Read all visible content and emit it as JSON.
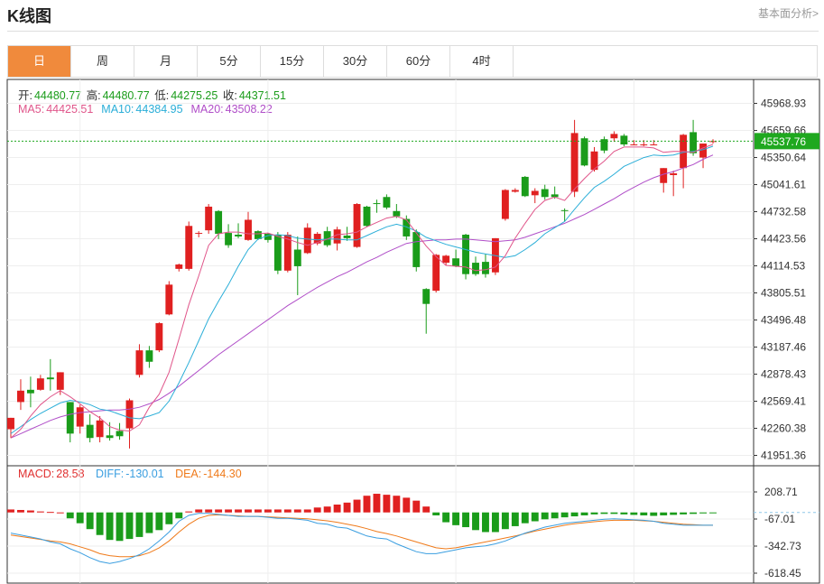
{
  "header": {
    "title": "K线图",
    "fundamental_link": "基本面分析>"
  },
  "tabs": [
    "日",
    "周",
    "月",
    "5分",
    "15分",
    "30分",
    "60分",
    "4时"
  ],
  "active_tab": 0,
  "ohlc_info": {
    "open_label": "开:",
    "open": "44480.77",
    "high_label": "高:",
    "high": "44480.77",
    "low_label": "低:",
    "low": "44275.25",
    "close_label": "收:",
    "close": "44371.51"
  },
  "ma_info": {
    "ma5_label": "MA5:",
    "ma5": "44425.51",
    "ma10_label": "MA10:",
    "ma10": "44384.95",
    "ma20_label": "MA20:",
    "ma20": "43508.22"
  },
  "macd_info": {
    "macd_label": "MACD:",
    "macd": "28.58",
    "diff_label": "DIFF:",
    "diff": "-130.01",
    "dea_label": "DEA:",
    "dea": "-144.30"
  },
  "colors": {
    "up": "#e02020",
    "down": "#1a9c1a",
    "ma5": "#e0558a",
    "ma10": "#2aaed8",
    "ma20": "#b04ec8",
    "diff": "#3a9ee0",
    "dea": "#ef7a1a",
    "tab_active": "#f08a3c",
    "current_price": "#1fa81f"
  },
  "chart_data": {
    "type": "candlestick",
    "price_axis_ticks": [
      "45968.93",
      "45659.66",
      "45350.64",
      "45041.61",
      "44732.58",
      "44423.56",
      "44114.53",
      "43805.51",
      "43496.48",
      "43187.46",
      "42878.43",
      "42569.41",
      "42260.38",
      "41951.36"
    ],
    "price_ylim": [
      41951.36,
      45968.93
    ],
    "current_price": "45537.76",
    "macd_axis_ticks": [
      "208.71",
      "-67.01",
      "-342.73",
      "-618.45"
    ],
    "macd_ylim": [
      -618.45,
      208.71
    ],
    "candles": [
      {
        "o": 42250,
        "h": 42380,
        "l": 42150,
        "c": 42380
      },
      {
        "o": 42560,
        "h": 42820,
        "l": 42470,
        "c": 42690
      },
      {
        "o": 42700,
        "h": 42850,
        "l": 42500,
        "c": 42660
      },
      {
        "o": 42700,
        "h": 42870,
        "l": 42690,
        "c": 42830
      },
      {
        "o": 42840,
        "h": 43050,
        "l": 42690,
        "c": 42820
      },
      {
        "o": 42700,
        "h": 42900,
        "l": 42640,
        "c": 42900
      },
      {
        "o": 42560,
        "h": 42560,
        "l": 42100,
        "c": 42200
      },
      {
        "o": 42280,
        "h": 42530,
        "l": 42200,
        "c": 42500
      },
      {
        "o": 42300,
        "h": 42420,
        "l": 42100,
        "c": 42150
      },
      {
        "o": 42160,
        "h": 42400,
        "l": 42100,
        "c": 42350
      },
      {
        "o": 42180,
        "h": 42330,
        "l": 42120,
        "c": 42150
      },
      {
        "o": 42230,
        "h": 42320,
        "l": 42130,
        "c": 42170
      },
      {
        "o": 42260,
        "h": 42600,
        "l": 42030,
        "c": 42580
      },
      {
        "o": 42870,
        "h": 43220,
        "l": 42840,
        "c": 43150
      },
      {
        "o": 43150,
        "h": 43200,
        "l": 42950,
        "c": 43020
      },
      {
        "o": 43150,
        "h": 43470,
        "l": 43130,
        "c": 43460
      },
      {
        "o": 43560,
        "h": 43940,
        "l": 43550,
        "c": 43900
      },
      {
        "o": 44080,
        "h": 44140,
        "l": 44050,
        "c": 44130
      },
      {
        "o": 44080,
        "h": 44620,
        "l": 44060,
        "c": 44570
      },
      {
        "o": 44480,
        "h": 44510,
        "l": 44440,
        "c": 44490
      },
      {
        "o": 44520,
        "h": 44820,
        "l": 44480,
        "c": 44790
      },
      {
        "o": 44740,
        "h": 44750,
        "l": 44420,
        "c": 44480
      },
      {
        "o": 44490,
        "h": 44590,
        "l": 44320,
        "c": 44350
      },
      {
        "o": 44470,
        "h": 44600,
        "l": 44430,
        "c": 44450
      },
      {
        "o": 44410,
        "h": 44730,
        "l": 44400,
        "c": 44640
      },
      {
        "o": 44510,
        "h": 44520,
        "l": 44410,
        "c": 44420
      },
      {
        "o": 44480,
        "h": 44490,
        "l": 44380,
        "c": 44410
      },
      {
        "o": 44470,
        "h": 44500,
        "l": 44020,
        "c": 44060
      },
      {
        "o": 44060,
        "h": 44500,
        "l": 44040,
        "c": 44470
      },
      {
        "o": 44300,
        "h": 44450,
        "l": 43780,
        "c": 44110
      },
      {
        "o": 44260,
        "h": 44600,
        "l": 44250,
        "c": 44550
      },
      {
        "o": 44370,
        "h": 44500,
        "l": 44350,
        "c": 44480
      },
      {
        "o": 44510,
        "h": 44560,
        "l": 44330,
        "c": 44350
      },
      {
        "o": 44370,
        "h": 44560,
        "l": 44290,
        "c": 44530
      },
      {
        "o": 44460,
        "h": 44560,
        "l": 44400,
        "c": 44430
      },
      {
        "o": 44330,
        "h": 44830,
        "l": 44320,
        "c": 44820
      },
      {
        "o": 44790,
        "h": 44800,
        "l": 44560,
        "c": 44570
      },
      {
        "o": 44830,
        "h": 44870,
        "l": 44720,
        "c": 44820
      },
      {
        "o": 44900,
        "h": 44930,
        "l": 44760,
        "c": 44780
      },
      {
        "o": 44740,
        "h": 44820,
        "l": 44660,
        "c": 44680
      },
      {
        "o": 44650,
        "h": 44690,
        "l": 44410,
        "c": 44450
      },
      {
        "o": 44500,
        "h": 44530,
        "l": 44050,
        "c": 44100
      },
      {
        "o": 43850,
        "h": 43860,
        "l": 43340,
        "c": 43680
      },
      {
        "o": 43830,
        "h": 44250,
        "l": 43810,
        "c": 44240
      },
      {
        "o": 44150,
        "h": 44240,
        "l": 44120,
        "c": 44230
      },
      {
        "o": 44200,
        "h": 44300,
        "l": 44100,
        "c": 44110
      },
      {
        "o": 44470,
        "h": 44480,
        "l": 43960,
        "c": 44020
      },
      {
        "o": 44150,
        "h": 44220,
        "l": 44000,
        "c": 44020
      },
      {
        "o": 44160,
        "h": 44250,
        "l": 43980,
        "c": 44020
      },
      {
        "o": 44040,
        "h": 44430,
        "l": 44010,
        "c": 44430
      },
      {
        "o": 44650,
        "h": 44990,
        "l": 44630,
        "c": 44980
      },
      {
        "o": 44960,
        "h": 45000,
        "l": 44950,
        "c": 44980
      },
      {
        "o": 45130,
        "h": 45140,
        "l": 44900,
        "c": 44910
      },
      {
        "o": 44920,
        "h": 45000,
        "l": 44830,
        "c": 44970
      },
      {
        "o": 44990,
        "h": 45040,
        "l": 44870,
        "c": 44900
      },
      {
        "o": 44930,
        "h": 45020,
        "l": 44880,
        "c": 44900
      },
      {
        "o": 44750,
        "h": 44770,
        "l": 44620,
        "c": 44740
      },
      {
        "o": 44960,
        "h": 45780,
        "l": 44900,
        "c": 45630
      },
      {
        "o": 45570,
        "h": 45590,
        "l": 45250,
        "c": 45260
      },
      {
        "o": 45210,
        "h": 45470,
        "l": 45190,
        "c": 45420
      },
      {
        "o": 45560,
        "h": 45590,
        "l": 45400,
        "c": 45430
      },
      {
        "o": 45570,
        "h": 45650,
        "l": 45530,
        "c": 45620
      },
      {
        "o": 45600,
        "h": 45620,
        "l": 45480,
        "c": 45500
      },
      {
        "o": 45500,
        "h": 45550,
        "l": 45490,
        "c": 45500
      },
      {
        "o": 45500,
        "h": 45550,
        "l": 45480,
        "c": 45500
      },
      {
        "o": 45500,
        "h": 45550,
        "l": 45490,
        "c": 45500
      },
      {
        "o": 45060,
        "h": 45230,
        "l": 44950,
        "c": 45230
      },
      {
        "o": 45150,
        "h": 45200,
        "l": 44910,
        "c": 45170
      },
      {
        "o": 45230,
        "h": 45620,
        "l": 45000,
        "c": 45610
      },
      {
        "o": 45640,
        "h": 45780,
        "l": 45370,
        "c": 45400
      },
      {
        "o": 45350,
        "h": 45510,
        "l": 45230,
        "c": 45510
      },
      {
        "o": 45530,
        "h": 45560,
        "l": 45510,
        "c": 45537.76
      }
    ],
    "ma5": [
      42150,
      42250,
      42400,
      42530,
      42620,
      42690,
      42620,
      42540,
      42450,
      42380,
      42280,
      42240,
      42230,
      42300,
      42500,
      42650,
      42900,
      43280,
      43670,
      44000,
      44350,
      44480,
      44500,
      44500,
      44480,
      44480,
      44490,
      44450,
      44420,
      44380,
      44350,
      44380,
      44420,
      44470,
      44480,
      44500,
      44560,
      44610,
      44660,
      44680,
      44640,
      44490,
      44340,
      44220,
      44120,
      44110,
      44100,
      44060,
      44070,
      44100,
      44230,
      44430,
      44600,
      44760,
      44860,
      44900,
      44860,
      44990,
      45110,
      45220,
      45310,
      45420,
      45470,
      45470,
      45470,
      45460,
      45410,
      45420,
      45420,
      45410,
      45460,
      45500
    ],
    "ma10": [
      42200,
      42280,
      42360,
      42430,
      42490,
      42550,
      42580,
      42560,
      42530,
      42480,
      42460,
      42420,
      42380,
      42370,
      42400,
      42440,
      42570,
      42780,
      43010,
      43260,
      43510,
      43710,
      43900,
      44110,
      44300,
      44420,
      44460,
      44470,
      44460,
      44430,
      44420,
      44410,
      44420,
      44420,
      44410,
      44410,
      44460,
      44510,
      44560,
      44590,
      44560,
      44510,
      44440,
      44400,
      44360,
      44330,
      44300,
      44270,
      44250,
      44230,
      44210,
      44230,
      44300,
      44380,
      44480,
      44550,
      44620,
      44760,
      44890,
      45010,
      45080,
      45160,
      45250,
      45300,
      45350,
      45380,
      45370,
      45380,
      45410,
      45420,
      45440,
      45480
    ],
    "ma20": [
      42150,
      42200,
      42250,
      42300,
      42350,
      42390,
      42420,
      42440,
      42450,
      42460,
      42470,
      42470,
      42480,
      42500,
      42540,
      42590,
      42660,
      42740,
      42830,
      42920,
      43010,
      43100,
      43180,
      43260,
      43340,
      43420,
      43500,
      43580,
      43660,
      43730,
      43800,
      43870,
      43930,
      43990,
      44040,
      44100,
      44160,
      44210,
      44270,
      44320,
      44370,
      44390,
      44400,
      44410,
      44410,
      44420,
      44420,
      44410,
      44400,
      44390,
      44400,
      44410,
      44440,
      44480,
      44520,
      44560,
      44600,
      44650,
      44700,
      44760,
      44820,
      44880,
      44950,
      45010,
      45070,
      45120,
      45160,
      45190,
      45230,
      45270,
      45330,
      45380
    ],
    "macd_hist": [
      30,
      25,
      20,
      10,
      5,
      0,
      -60,
      -110,
      -170,
      -230,
      -280,
      -290,
      -270,
      -250,
      -210,
      -180,
      -120,
      -60,
      10,
      30,
      30,
      30,
      30,
      30,
      30,
      30,
      30,
      30,
      30,
      30,
      30,
      50,
      60,
      80,
      100,
      130,
      170,
      190,
      180,
      170,
      150,
      120,
      60,
      -30,
      -100,
      -130,
      -150,
      -180,
      -200,
      -200,
      -170,
      -140,
      -110,
      -90,
      -70,
      -60,
      -50,
      -40,
      -30,
      -20,
      -15,
      -15,
      -20,
      -25,
      -30,
      -35,
      -30,
      -25,
      -20,
      -15,
      -10,
      -5
    ],
    "diff": [
      -210,
      -230,
      -250,
      -270,
      -300,
      -320,
      -370,
      -410,
      -460,
      -500,
      -520,
      -500,
      -470,
      -430,
      -370,
      -290,
      -200,
      -90,
      -30,
      -10,
      -10,
      -20,
      -30,
      -40,
      -40,
      -40,
      -50,
      -60,
      -60,
      -70,
      -80,
      -110,
      -120,
      -150,
      -160,
      -200,
      -240,
      -260,
      -270,
      -320,
      -360,
      -400,
      -420,
      -420,
      -400,
      -380,
      -360,
      -350,
      -340,
      -320,
      -290,
      -250,
      -210,
      -180,
      -150,
      -130,
      -110,
      -100,
      -90,
      -80,
      -70,
      -65,
      -70,
      -75,
      -80,
      -90,
      -110,
      -120,
      -130,
      -130,
      -130,
      -130
    ],
    "dea": [
      -230,
      -245,
      -260,
      -275,
      -290,
      -300,
      -320,
      -350,
      -380,
      -420,
      -440,
      -450,
      -450,
      -440,
      -410,
      -360,
      -290,
      -200,
      -120,
      -60,
      -30,
      -25,
      -30,
      -35,
      -40,
      -40,
      -45,
      -50,
      -55,
      -60,
      -65,
      -75,
      -85,
      -100,
      -120,
      -140,
      -165,
      -195,
      -215,
      -240,
      -270,
      -300,
      -330,
      -360,
      -370,
      -360,
      -340,
      -320,
      -300,
      -280,
      -260,
      -240,
      -215,
      -190,
      -170,
      -150,
      -130,
      -115,
      -105,
      -95,
      -85,
      -80,
      -80,
      -80,
      -85,
      -90,
      -100,
      -110,
      -120,
      -125,
      -130,
      -130
    ]
  }
}
